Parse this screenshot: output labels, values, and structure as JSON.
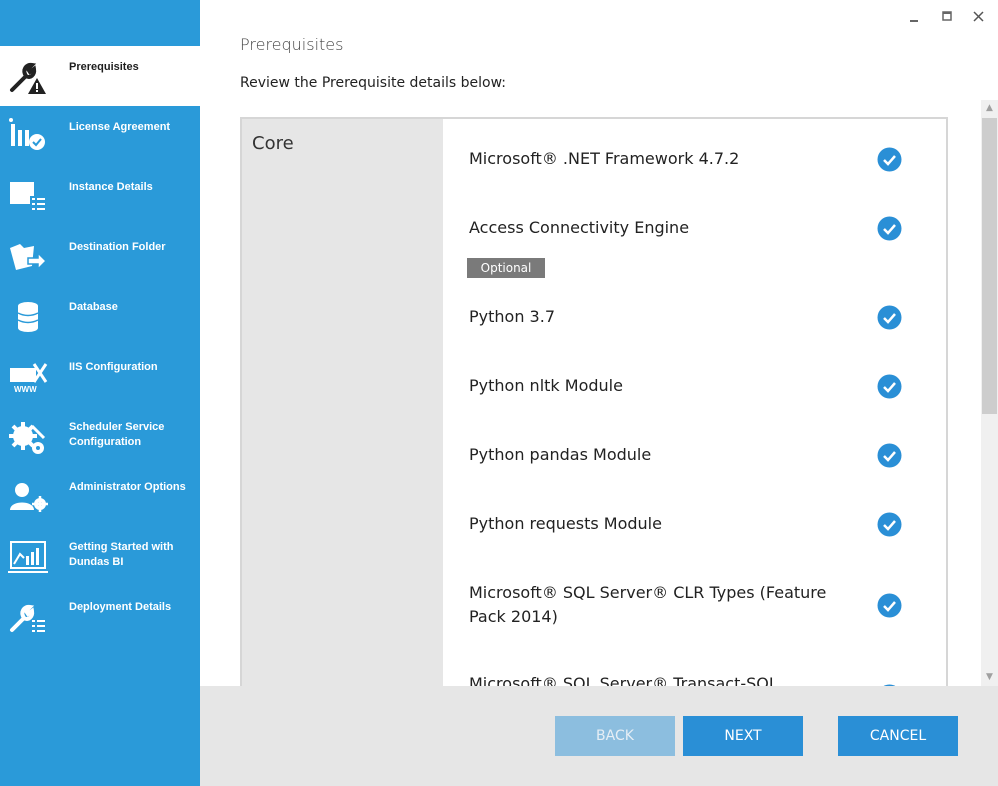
{
  "window": {
    "minimize_icon": "minimize-icon",
    "maximize_icon": "maximize-icon",
    "close_icon": "close-icon"
  },
  "sidebar": {
    "items": [
      {
        "label": "Prerequisites",
        "icon": "wrench-warning-icon",
        "active": true
      },
      {
        "label": "License Agreement",
        "icon": "license-check-icon",
        "active": false
      },
      {
        "label": "Instance Details",
        "icon": "instance-list-icon",
        "active": false
      },
      {
        "label": "Destination Folder",
        "icon": "folder-arrow-icon",
        "active": false
      },
      {
        "label": "Database",
        "icon": "database-icon",
        "active": false
      },
      {
        "label": "IIS Configuration",
        "icon": "iis-www-icon",
        "active": false
      },
      {
        "label": "Scheduler Service Configuration",
        "icon": "gears-icon",
        "active": false
      },
      {
        "label": "Administrator Options",
        "icon": "user-gear-icon",
        "active": false
      },
      {
        "label": "Getting Started with Dundas BI",
        "icon": "chart-screen-icon",
        "active": false
      },
      {
        "label": "Deployment Details",
        "icon": "wrench-list-icon",
        "active": false
      }
    ]
  },
  "main": {
    "title": "Prerequisites",
    "subtitle": "Review the Prerequisite details below:",
    "category": "Core",
    "optional_label": "Optional",
    "requirements": [
      {
        "name": "Microsoft® .NET Framework 4.7.2",
        "status": "check-icon"
      },
      {
        "name": "Access Connectivity Engine",
        "status": "check-icon",
        "optional": true
      },
      {
        "name": "Python 3.7",
        "status": "check-icon"
      },
      {
        "name": "Python nltk Module",
        "status": "check-icon"
      },
      {
        "name": "Python pandas Module",
        "status": "check-icon"
      },
      {
        "name": "Python requests Module",
        "status": "check-icon"
      },
      {
        "name": "Microsoft® SQL Server® CLR Types (Feature Pack 2014)",
        "status": "check-icon"
      },
      {
        "name": "Microsoft® SQL Server® Transact-SQL",
        "status": "check-icon"
      }
    ]
  },
  "footer": {
    "back_label": "BACK",
    "next_label": "NEXT",
    "cancel_label": "CANCEL"
  },
  "colors": {
    "sidebar": "#2a9ad9",
    "accent": "#2a8fd6",
    "check": "#2a8fd6",
    "badge": "#7a7a7a"
  }
}
